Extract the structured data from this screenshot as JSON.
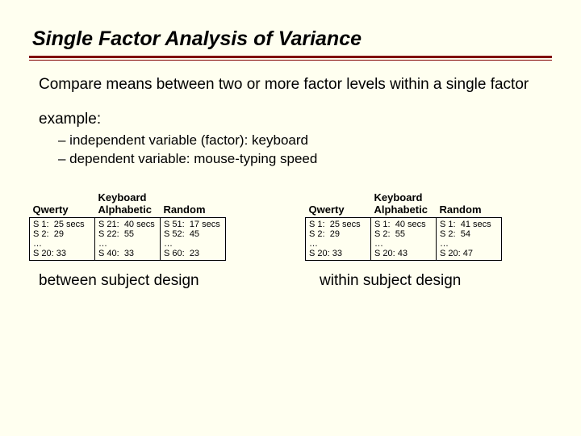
{
  "title": "Single Factor Analysis of Variance",
  "intro": "Compare means between two or more factor levels within a single factor",
  "example_label": "example:",
  "bullets": {
    "b1": "– independent variable (factor): keyboard",
    "b2": "– dependent variable: mouse-typing speed"
  },
  "headers": {
    "qwerty": "Qwerty",
    "alphabetic_top": "Keyboard",
    "alphabetic_bottom": "Alphabetic",
    "random": "Random"
  },
  "between": {
    "caption": "between subject design",
    "cols": [
      {
        "r1a": "S 1:",
        "r1b": "25 secs",
        "r2a": "S 2:",
        "r2b": "29",
        "r3": "…",
        "r4a": "S 20:",
        "r4b": "33"
      },
      {
        "r1a": "S 21:",
        "r1b": "40 secs",
        "r2a": "S 22:",
        "r2b": "55",
        "r3": "…",
        "r4a": "S 40:",
        "r4b": "33"
      },
      {
        "r1a": "S 51:",
        "r1b": "17 secs",
        "r2a": "S 52:",
        "r2b": "45",
        "r3": "…",
        "r4a": "S 60:",
        "r4b": "23"
      }
    ]
  },
  "within": {
    "caption": "within subject design",
    "cols": [
      {
        "r1a": "S 1:",
        "r1b": "25 secs",
        "r2a": "S 2:",
        "r2b": "29",
        "r3": "…",
        "r4a": "S 20:",
        "r4b": "33"
      },
      {
        "r1a": "S 1:",
        "r1b": "40 secs",
        "r2a": "S 2:",
        "r2b": "55",
        "r3": "…",
        "r4a": "S 20:",
        "r4b": "43"
      },
      {
        "r1a": "S 1:",
        "r1b": "41 secs",
        "r2a": "S 2:",
        "r2b": "54",
        "r3": "…",
        "r4a": "S 20:",
        "r4b": "47"
      }
    ]
  }
}
